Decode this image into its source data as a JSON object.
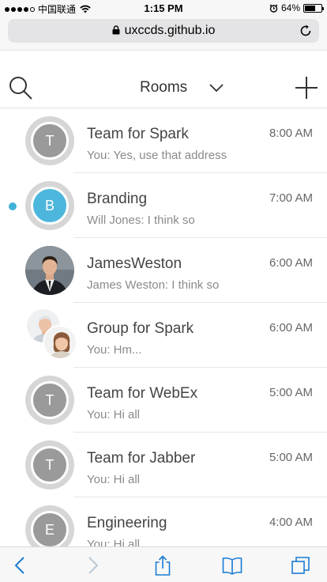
{
  "status_bar": {
    "carrier": "中国联通",
    "time": "1:15 PM",
    "battery": "64%",
    "battery_level": 0.64
  },
  "browser": {
    "url": "uxccds.github.io"
  },
  "header": {
    "title": "Rooms"
  },
  "rooms": [
    {
      "name": "Team for Spark",
      "time": "8:00 AM",
      "preview": "You: Yes, use that address",
      "avatar_letter": "T",
      "avatar_type": "letter",
      "unread": false
    },
    {
      "name": "Branding",
      "time": "7:00 AM",
      "preview": "Will Jones: I think so",
      "avatar_letter": "B",
      "avatar_type": "letter-blue",
      "unread": true
    },
    {
      "name": "JamesWeston",
      "time": "6:00 AM",
      "preview": "James Weston: I think so",
      "avatar_letter": "",
      "avatar_type": "photo",
      "unread": false
    },
    {
      "name": "Group for Spark",
      "time": "6:00 AM",
      "preview": "You: Hm...",
      "avatar_letter": "",
      "avatar_type": "group",
      "unread": false
    },
    {
      "name": "Team for WebEx",
      "time": "5:00 AM",
      "preview": "You: Hi all",
      "avatar_letter": "T",
      "avatar_type": "letter",
      "unread": false
    },
    {
      "name": "Team for Jabber",
      "time": "5:00 AM",
      "preview": "You: Hi all",
      "avatar_letter": "T",
      "avatar_type": "letter",
      "unread": false
    },
    {
      "name": "Engineering",
      "time": "4:00 AM",
      "preview": "You: Hi all",
      "avatar_letter": "E",
      "avatar_type": "letter",
      "unread": false
    }
  ],
  "colors": {
    "unread_dot": "#3fb2d9",
    "toolbar_icon": "#1a7bd4",
    "toolbar_icon_disabled": "#b9c9d8"
  },
  "icons": {
    "search": "search-icon",
    "chevron": "chevron-down-icon",
    "add": "plus-icon",
    "lock": "lock-icon",
    "reload": "reload-icon",
    "back": "back-arrow-icon",
    "forward": "forward-arrow-icon",
    "share": "share-icon",
    "bookmarks": "bookmarks-icon",
    "tabs": "tabs-icon"
  }
}
